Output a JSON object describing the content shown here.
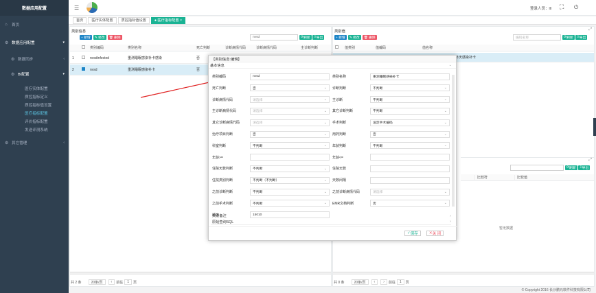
{
  "sidebar": {
    "title": "数据应用配置",
    "items": [
      {
        "label": "首页",
        "icon": "home-icon"
      },
      {
        "label": "数据应用配置",
        "icon": "gear-icon"
      },
      {
        "label": "数据同步",
        "icon": "gear-icon"
      },
      {
        "label": "BI配置",
        "icon": "gear-icon"
      },
      {
        "label": "医疗实体配置"
      },
      {
        "label": "质控指标定义"
      },
      {
        "label": "质控指标值设置"
      },
      {
        "label": "医疗指标配置"
      },
      {
        "label": "评价指标配置"
      },
      {
        "label": "发送评测系统"
      },
      {
        "label": "其它管理",
        "icon": "gear-icon"
      }
    ]
  },
  "topbar": {
    "user": "登录人员：",
    "user_name": "lll"
  },
  "tabs": [
    "首页",
    "医疗实体配置",
    "质控指标值设置",
    "● 医疗指标配置 ×"
  ],
  "left_panel": {
    "title": "类别信息",
    "search": "nvsd",
    "buttons": {
      "add": "+ 新增",
      "edit": "✎ 修改",
      "del": "🗑 删除",
      "refresh": "刷新",
      "export": "导出"
    },
    "columns": [
      "类别编码",
      "类别名称",
      "死亡判断",
      "诊断病情代码",
      "诊断病情代码",
      "主诊断判断"
    ],
    "rows": [
      {
        "num": "1",
        "code": "nvsdinfected",
        "name": "重测睡眠感染补卡感染",
        "flag": "否"
      },
      {
        "num": "2",
        "code": "nvsd",
        "name": "重测睡眠感染补卡",
        "flag": "否"
      }
    ],
    "pager": {
      "total": "共 2 条",
      "size": "20条/页",
      "goto": "前往",
      "page": "1",
      "page_suffix": "页"
    }
  },
  "right_panel": {
    "title": "类别值",
    "placeholder": "编码名称",
    "columns": [
      "值类别",
      "值编码",
      "值名称"
    ],
    "row_text": "测补补天感染补卡",
    "buttons": {
      "add": "+ 新增",
      "edit": "✎ 修改",
      "del": "🗑 删除",
      "refresh": "刷新",
      "export": "导出"
    },
    "cols2": [
      "比较符",
      "比较值"
    ],
    "empty": "暂无数据",
    "pager": {
      "total": "共 0 条",
      "size": "20条/页",
      "goto": "前往",
      "page": "1",
      "page_suffix": "页"
    }
  },
  "modal": {
    "title": "【类别信息:编辑】",
    "section1": "基本信息",
    "section2": "类别备注",
    "section3": "原始查询SQL",
    "save": "保存",
    "close": "关 闭",
    "fields": [
      {
        "l": "类别编码",
        "v": "nvsd"
      },
      {
        "l": "类别名称",
        "v": "重测睡眠感染补卡"
      },
      {
        "l": "死亡判断",
        "v": "否"
      },
      {
        "l": "诊断判断",
        "v": "不判断"
      },
      {
        "l": "诊断病情代码",
        "v": "请选择"
      },
      {
        "l": "主诊断",
        "v": "不判断"
      },
      {
        "l": "主诊断病情代码",
        "v": "请选择"
      },
      {
        "l": "其它诊断判断",
        "v": "不判断"
      },
      {
        "l": "其它诊断病情代码",
        "v": "请选择"
      },
      {
        "l": "手术判断",
        "v": "设定手术编码"
      },
      {
        "l": "治疗项目判断",
        "v": "否"
      },
      {
        "l": "用药判断",
        "v": "否"
      },
      {
        "l": "科室判断",
        "v": "不判断"
      },
      {
        "l": "年龄判断",
        "v": "不判断"
      },
      {
        "l": "年龄>=",
        "v": ""
      },
      {
        "l": "年龄<=",
        "v": ""
      },
      {
        "l": "住院天数判断",
        "v": "不判断"
      },
      {
        "l": "住院天数",
        "v": ""
      },
      {
        "l": "住院类别判断",
        "v": "不判断（不判断）"
      },
      {
        "l": "天数间隔",
        "v": ""
      },
      {
        "l": "之前诊断判断",
        "v": "不判断"
      },
      {
        "l": "之前诊断病情代码",
        "v": "请选择"
      },
      {
        "l": "之前手术判断",
        "v": "不判断"
      },
      {
        "l": "EMR文档判断",
        "v": "否"
      },
      {
        "l": "顺序",
        "v": "15010"
      }
    ]
  },
  "footer": "© Copyright 2016 长沙鹏元软件科技有限公司"
}
